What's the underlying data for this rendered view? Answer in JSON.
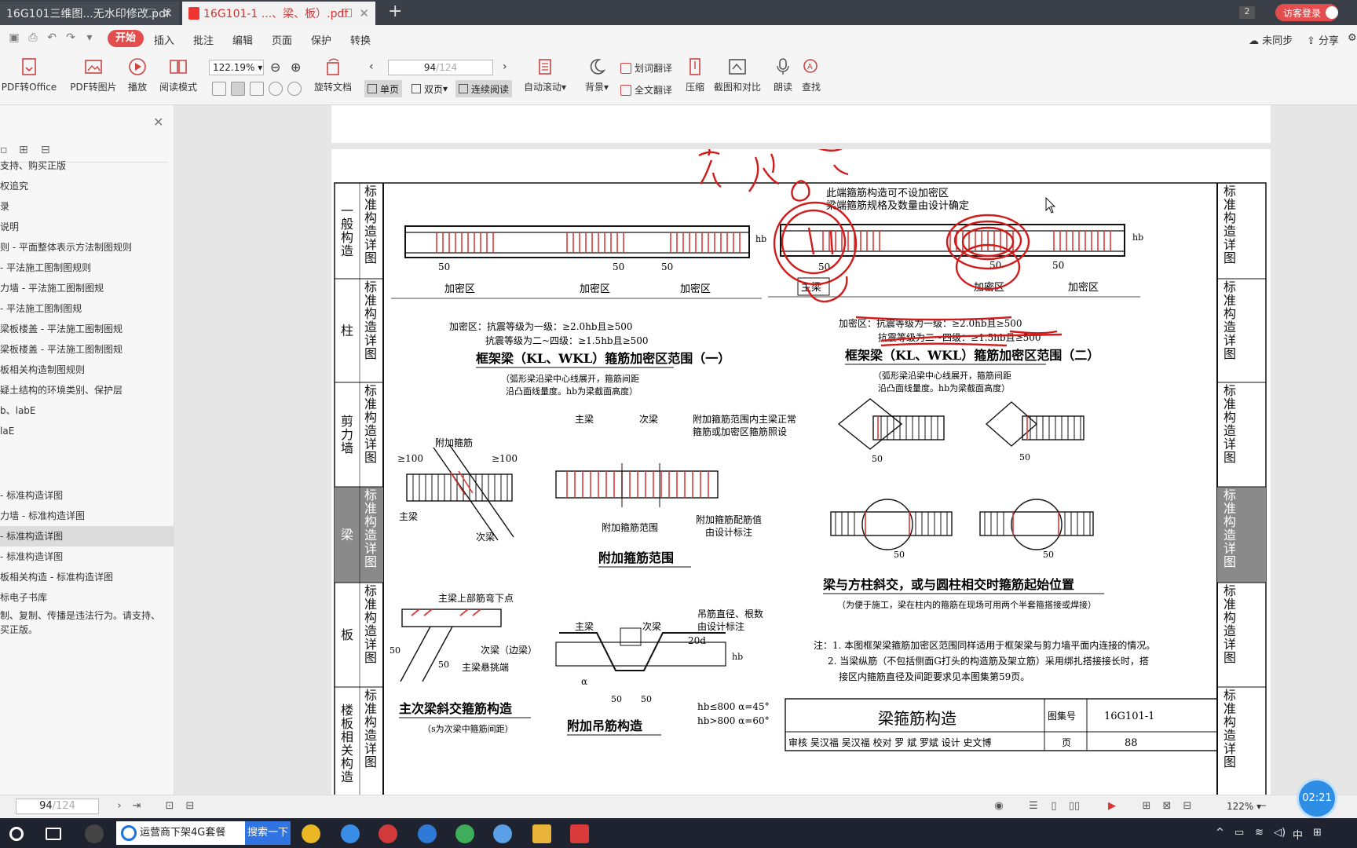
{
  "tabs": [
    {
      "label": "16G101三维图...无水印修改.pdf"
    },
    {
      "label": "16G101-1 ...、梁、板）.pdf"
    }
  ],
  "title_bar": {
    "window_count": "2",
    "visitor_login": "访客登录"
  },
  "menu": {
    "items": [
      "开始",
      "插入",
      "批注",
      "编辑",
      "页面",
      "保护",
      "转换"
    ],
    "right": [
      "未同步",
      "分享"
    ]
  },
  "toolbar": {
    "pdf_to_office": "PDF转Office",
    "pdf_to_image": "PDF转图片",
    "play": "播放",
    "read_mode": "阅读模式",
    "zoom": "122.19%",
    "rotate": "旋转文档",
    "page_current": "94",
    "page_total": "/124",
    "single_page": "单页",
    "double_page": "双页",
    "continuous": "连续阅读",
    "auto_scroll": "自动滚动",
    "background": "背景",
    "word_translate": "划词翻译",
    "full_translate": "全文翻译",
    "compress": "压缩",
    "screenshot_compare": "截图和对比",
    "read_aloud": "朗读",
    "find": "查找"
  },
  "sidebar": {
    "outline": [
      "支持、购买正版",
      "权追究",
      "录",
      "说明",
      "则 - 平面整体表示方法制图规则",
      " - 平法施工图制图规则",
      "力墙 - 平法施工图制图规",
      " - 平法施工图制图规",
      "梁板楼盖 - 平法施工图制图规",
      "梁板楼盖 - 平法施工图制图规",
      "板相关构造制图规则",
      "疑土结构的环境类别、保护层",
      "b、labE",
      "  laE",
      "",
      "",
      " - 标准构造详图",
      "力墙 - 标准构造详图",
      " - 标准构造详图",
      " - 标准构造详图",
      "板相关构造 - 标准构造详图",
      "标电子书库",
      "制、复制、传播是违法行为。请支持、",
      "买正版。"
    ],
    "selected_index": 18
  },
  "doc": {
    "left_tabs": [
      {
        "main": "一般构造",
        "sub": "标准构造详图"
      },
      {
        "main": "柱",
        "sub": "标准构造详图"
      },
      {
        "main": "剪力墙",
        "sub": "标准构造详图"
      },
      {
        "main": "梁",
        "sub": "标准构造详图"
      },
      {
        "main": "板",
        "sub": "标准构造详图"
      },
      {
        "main": "楼板相关构造",
        "sub": "标准构造详图"
      }
    ],
    "right_tabs": [
      "标准构造详图",
      "标准构造详图",
      "标准构造详图",
      "标准构造详图",
      "标准构造详图",
      "标准构造详图"
    ],
    "top_note1": "此端箍筋构造可不设加密区",
    "top_note2": "梁端箍筋规格及数量由设计确定",
    "dense_zone": "加密区",
    "dim50": "50",
    "hb": "hb",
    "main_beam": "主梁",
    "dense_rule_1a": "加密区：抗震等级为一级：≥2.0hb且≥500",
    "dense_rule_1b": "抗震等级为二~四级：≥1.5hb且≥500",
    "title1": "框架梁（KL、WKL）箍筋加密区范围（一）",
    "title1_sub1": "（弧形梁沿梁中心线展开，箍筋间距",
    "title1_sub2": "沿凸面线量度。hb为梁截面高度）",
    "dense_rule_2a": "加密区：抗震等级为一级：≥2.0hb且≥500",
    "dense_rule_2b": "抗震等级为二~四级：≥1.5hb且≥500",
    "title2": "框架梁（KL、WKL）箍筋加密区范围（二）",
    "title2_sub1": "（弧形梁沿梁中心线展开，箍筋间距",
    "title2_sub2": "沿凸面线量度。hb为梁截面高度）",
    "add_stirrup": "附加箍筋",
    "ge100": "≥100",
    "secondary_beam": "次梁",
    "add_stirrup_note1": "附加箍筋范围内主梁正常",
    "add_stirrup_note2": "箍筋或加密区箍筋照设",
    "add_stirrup_range": "附加箍筋范围",
    "add_stirrup_value1": "附加箍筋配筋值",
    "add_stirrup_value2": "由设计标注",
    "title3": "附加箍筋范围",
    "oblique_title": "梁与方柱斜交，或与圆柱相交时箍筋起始位置",
    "oblique_sub": "（为便于施工，梁在柱内的箍筋在现场可用两个半套箍搭接或焊接）",
    "bend_point": "主梁上部筋弯下点",
    "secondary_edge": "次梁（边梁）",
    "cantilever": "主梁悬挑端",
    "title4": "主次梁斜交箍筋构造",
    "title4_sub": "（s为次梁中箍筋间距）",
    "hanger_note1": "吊筋直径、根数",
    "hanger_note2": "由设计标注",
    "d20": "20d",
    "alpha": "α",
    "alpha45": "hb≤800  α=45°",
    "alpha60": "hb>800  α=60°",
    "title5": "附加吊筋构造",
    "note1": "注：1. 本图框架梁箍筋加密区范围同样适用于框架梁与剪力墙平面内连接的情况。",
    "note2": "2. 当梁纵筋（不包括侧面G打头的构造筋及架立筋）采用绑扎搭接接长时，搭",
    "note3": "接区内箍筋直径及间距要求见本图集第59页。",
    "sheet_title": "梁箍筋构造",
    "atlas_label": "图集号",
    "atlas_no": "16G101-1",
    "page_label": "页",
    "page_no": "88",
    "sign_row": "审核 吴汉福 吴汉福 校对 罗 斌 罗斌 设计 史文博"
  },
  "statusbar": {
    "page_current": "94",
    "page_total": "/124",
    "zoom": "122%",
    "timer": "02:21"
  },
  "taskbar": {
    "search_text": "运营商下架4G套餐",
    "search_btn": "搜索一下",
    "ime": "中"
  },
  "colors": {
    "accent_red": "#e34d4d",
    "ink_red": "#d11a1a",
    "hatch_red": "#d93a3a",
    "blue": "#2e8ee6"
  }
}
